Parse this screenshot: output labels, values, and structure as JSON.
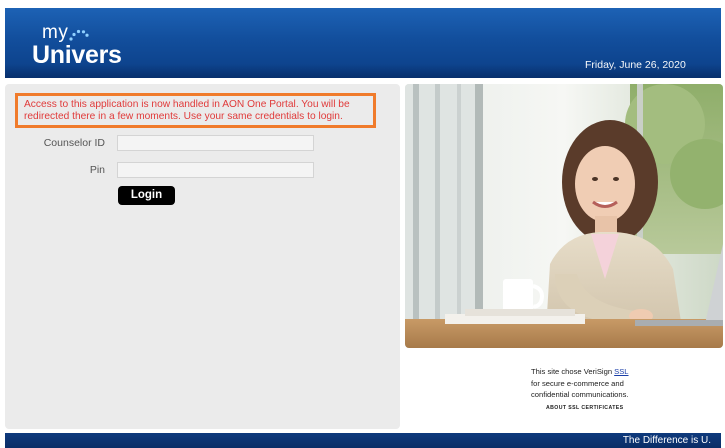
{
  "header": {
    "logo_small": "my",
    "logo_main": "Univers",
    "date": "Friday, June 26, 2020"
  },
  "notice": {
    "line1": "Access to this application is now handled in AON One Portal. You will be",
    "line2": "redirected there in a few moments. Use your same credentials to login."
  },
  "form": {
    "counselor_label": "Counselor ID",
    "counselor_value": "",
    "pin_label": "Pin",
    "pin_value": "",
    "login_label": "Login"
  },
  "ssl": {
    "line1_prefix": "This site chose VeriSign ",
    "line1_link": "SSL",
    "line2": "for secure e-commerce and",
    "line3": "confidential communications.",
    "about": "ABOUT SSL CERTIFICATES"
  },
  "footer": {
    "tagline": "The Difference is U."
  },
  "colors": {
    "header_blue": "#124e9c",
    "notice_border": "#f07b2b",
    "notice_text": "#e03a3a",
    "panel_gray": "#ebebeb",
    "footer_navy": "#0a2d66"
  }
}
